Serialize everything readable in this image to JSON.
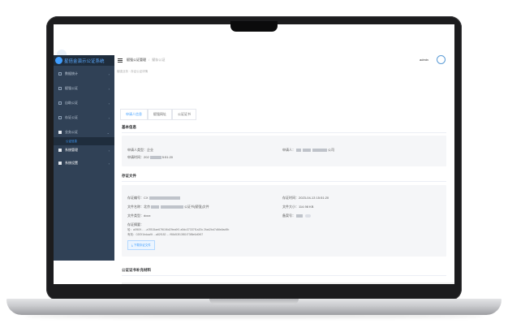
{
  "app": {
    "title": "星倍金演示公证系统",
    "user": "admin"
  },
  "breadcrumb": {
    "root": "赋强公证管理",
    "current": "赋存公证"
  },
  "page": {
    "subtitle": "赋强业务 · 存证公证详情"
  },
  "sidebar": {
    "items": [
      {
        "label": "数据统计"
      },
      {
        "label": "赋强公证"
      },
      {
        "label": "自助公证"
      },
      {
        "label": "存证公证"
      },
      {
        "label": "业务公证",
        "sub": "公证信息"
      },
      {
        "label": "系统管理"
      },
      {
        "label": "系统设置"
      }
    ]
  },
  "tabs": [
    "申请人信息",
    "赋强网址",
    "公证证书"
  ],
  "basic": {
    "title": "基本信息",
    "applicant_type_label": "申请人类型：",
    "applicant_type_value": "企业",
    "apply_time_label": "申请时间：",
    "apply_time_value": "202",
    "apply_time_tail": "5:51:20",
    "applicant_label": "申请人：",
    "applicant_tail": "公司"
  },
  "evidence": {
    "title": "存证文件",
    "no_label": "存证编号：",
    "no_value": "CX",
    "name_label": "文件名称：",
    "name_value": "北京",
    "name_tail": "公证书(赋强)文件",
    "type_label": "文件类型：",
    "type_value": "docx",
    "digest_label": "存证摘要：",
    "digest_line1": "哈：a0f60f...  ...a7f815ae67f61f6d29ea9f1   a5dc37337f1a20c   2fad2bd7d6fa9ad9b",
    "digest_line2": "有效：02f2f1bdaa9t   ...a82f182 ...  f98d53f13f81f73f8e6d0f67",
    "time_label": "存证时间：",
    "time_value": "2023-04-13 15:51:20",
    "size_label": "文件大小：",
    "size_value": "114.98 KB",
    "flag_label": "备案号：",
    "download_label": "下载存证文件"
  },
  "supplement": {
    "title": "公证证书补充材料"
  },
  "icons": {
    "logo": "logo-icon",
    "menu": "hamburger-icon",
    "avatar": "avatar-icon",
    "download": "download-icon"
  },
  "colors": {
    "sidebar": "#304156",
    "brand_bg": "#1f2d3d",
    "accent": "#409eff"
  }
}
